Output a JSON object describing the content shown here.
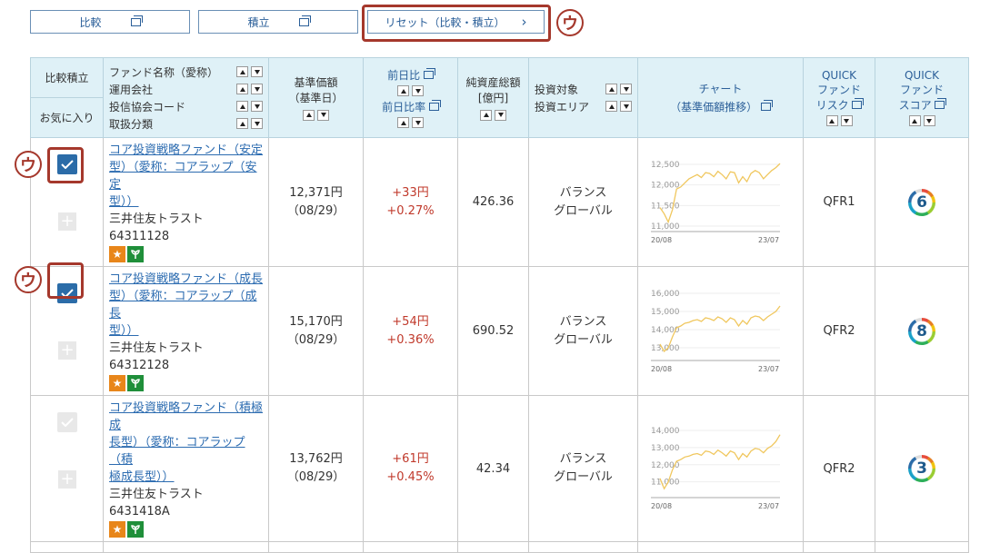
{
  "top_buttons": {
    "compare": "比較",
    "accumulate": "積立",
    "reset": "リセット（比較・積立）",
    "reset_arrow": "›"
  },
  "marker": "ウ",
  "header": {
    "col1_top": "比較積立",
    "col1_bottom": "お気に入り",
    "fund_lines": [
      "ファンド名称（愛称）",
      "運用会社",
      "投信協会コード",
      "取扱分類"
    ],
    "nav_l1": "基準価額",
    "nav_l2": "（基準日）",
    "change_l1": "前日比",
    "change_l2": "前日比率",
    "assets_l1": "純資産総額",
    "assets_l2": "[億円]",
    "target_l1": "投資対象",
    "target_l2": "投資エリア",
    "chart_l1": "チャート",
    "chart_l2": "（基準価額推移）",
    "risk_l1": "QUICK",
    "risk_l2": "ファンド",
    "risk_l3": "リスク",
    "score_l1": "QUICK",
    "score_l2": "ファンド",
    "score_l3": "スコア"
  },
  "funds": [
    {
      "name": "コア投資戦略ファンド（安定型）（愛称：コアラップ（安定型））",
      "name_lines": [
        "コア投資戦略ファンド（安定",
        "型）（愛称：コアラップ（安定",
        "型））"
      ],
      "company": "三井住友トラスト",
      "code": "64311128",
      "nav": "12,371円",
      "nav_date": "（08/29）",
      "change": "+33円",
      "change_rate": "+0.27%",
      "assets": "426.36",
      "target": "バランス",
      "area": "グローバル",
      "checked": true,
      "risk": "QFR1",
      "score": "6",
      "chart": {
        "yticks": [
          "12,500",
          "12,000",
          "11,500",
          "11,000"
        ],
        "ymin": 11000,
        "ymax": 12500,
        "xstart": "20/08",
        "xend": "23/07",
        "values": [
          11450,
          11300,
          11100,
          11400,
          11900,
          11950,
          12050,
          12150,
          12200,
          12250,
          12180,
          12300,
          12280,
          12200,
          12330,
          12250,
          12150,
          12320,
          12300,
          12050,
          12200,
          12080,
          12280,
          12350,
          12300,
          12150,
          12250,
          12350,
          12420,
          12520
        ]
      }
    },
    {
      "name": "コア投資戦略ファンド（成長型）（愛称：コアラップ（成長型））",
      "name_lines": [
        "コア投資戦略ファンド（成長",
        "型）（愛称：コアラップ（成長",
        "型））"
      ],
      "company": "三井住友トラスト",
      "code": "64312128",
      "nav": "15,170円",
      "nav_date": "（08/29）",
      "change": "+54円",
      "change_rate": "+0.36%",
      "assets": "690.52",
      "target": "バランス",
      "area": "グローバル",
      "checked": true,
      "risk": "QFR2",
      "score": "8",
      "chart": {
        "yticks": [
          "16,000",
          "15,000",
          "14,000",
          "13,000"
        ],
        "ymin": 12600,
        "ymax": 16000,
        "xstart": "20/08",
        "xend": "23/07",
        "values": [
          13200,
          12800,
          13000,
          13600,
          14100,
          14200,
          14350,
          14400,
          14500,
          14550,
          14450,
          14650,
          14600,
          14500,
          14700,
          14600,
          14400,
          14650,
          14550,
          14200,
          14500,
          14300,
          14650,
          14750,
          14700,
          14500,
          14700,
          14850,
          15000,
          15300
        ]
      }
    },
    {
      "name": "コア投資戦略ファンド（積極成長型）（愛称：コアラップ（積極成長型））",
      "name_lines": [
        "コア投資戦略ファンド（積極成",
        "長型）（愛称：コアラップ（積",
        "極成長型））"
      ],
      "company": "三井住友トラスト",
      "code": "6431418A",
      "nav": "13,762円",
      "nav_date": "（08/29）",
      "change": "+61円",
      "change_rate": "+0.45%",
      "assets": "42.34",
      "target": "バランス",
      "area": "グローバル",
      "checked": false,
      "risk": "QFR2",
      "score": "3",
      "chart": {
        "yticks": [
          "14,000",
          "13,000",
          "12,000",
          "11,000"
        ],
        "ymin": 10400,
        "ymax": 14000,
        "xstart": "20/08",
        "xend": "23/07",
        "values": [
          11200,
          10600,
          11000,
          11700,
          12200,
          12300,
          12450,
          12500,
          12600,
          12650,
          12550,
          12800,
          12750,
          12600,
          12850,
          12700,
          12500,
          12800,
          12700,
          12300,
          12650,
          12450,
          12800,
          12950,
          12900,
          12700,
          12950,
          13100,
          13350,
          13750
        ]
      }
    }
  ],
  "colors": {
    "accent": "#2b6ca8",
    "header_bg": "#dff1f7",
    "highlight": "#a5382c",
    "line": "#f0c75e",
    "up": "#c0392b",
    "badge_star": "#e8861a",
    "badge_leaf": "#1f8f3a"
  }
}
